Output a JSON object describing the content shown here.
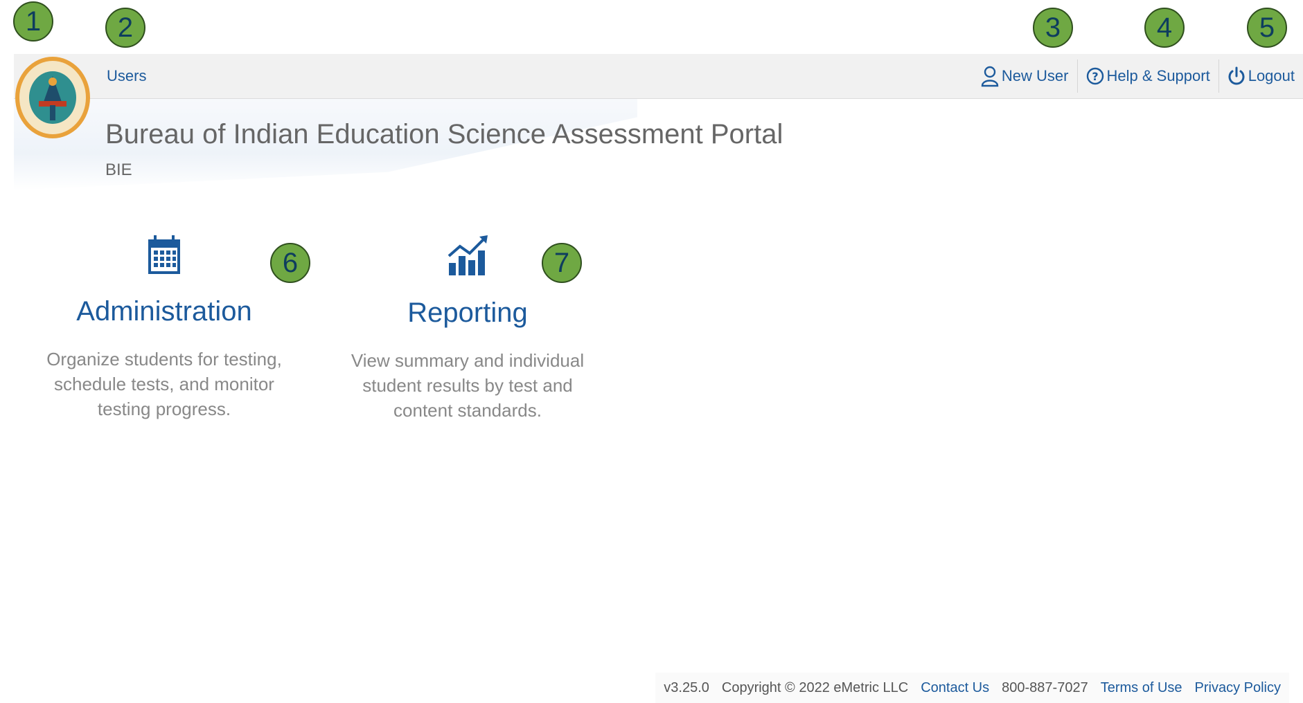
{
  "annotations": [
    "1",
    "2",
    "3",
    "4",
    "5",
    "6",
    "7"
  ],
  "nav": {
    "users": "Users",
    "new_user": "New User",
    "help": "Help & Support",
    "logout": "Logout"
  },
  "header": {
    "title": "Bureau of Indian Education Science Assessment Portal",
    "subtitle": "BIE"
  },
  "tiles": [
    {
      "icon": "calendar-icon",
      "title": "Administration",
      "description": "Organize students for testing, schedule tests, and monitor testing progress."
    },
    {
      "icon": "chart-up-icon",
      "title": "Reporting",
      "description": "View summary and individual student results by test and content standards."
    }
  ],
  "footer": {
    "version": "v3.25.0",
    "copyright": "Copyright © 2022 eMetric LLC",
    "contact": "Contact Us",
    "phone": "800-887-7027",
    "terms": "Terms of Use",
    "privacy": "Privacy Policy"
  },
  "colors": {
    "accent": "#1c5a9c",
    "badge_fill": "#6fa843"
  }
}
